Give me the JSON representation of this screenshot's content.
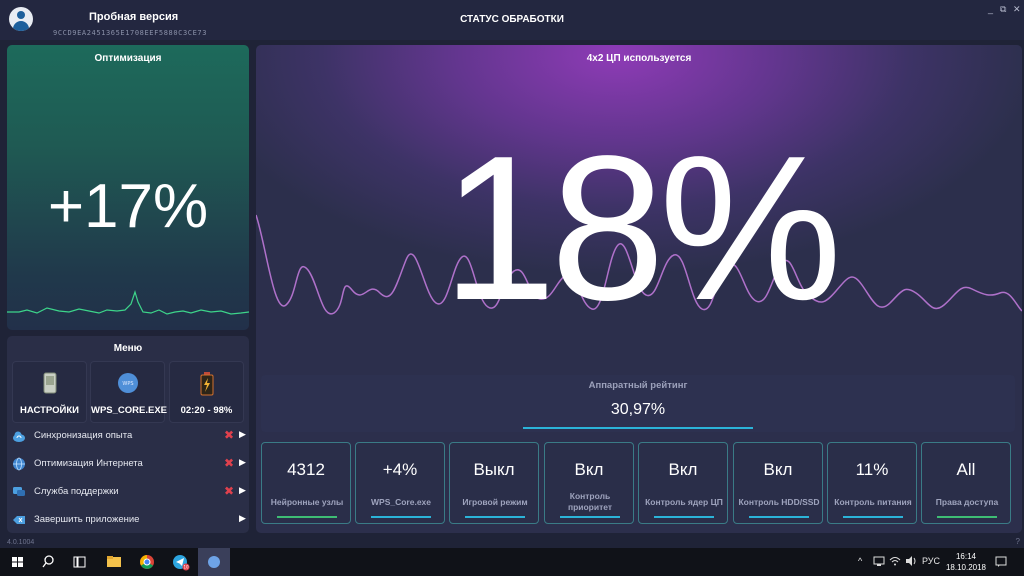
{
  "titlebar": {
    "app_title": "Пробная версия",
    "app_id": "9CCD9EA2451365E1708EEF5880C3CE73",
    "center_title": "СТАТУС ОБРАБОТКИ",
    "minimize": "_",
    "restore": "⧉",
    "close": "✕"
  },
  "optimization": {
    "title": "Оптимизация",
    "value": "+17%"
  },
  "menu": {
    "title": "Меню",
    "tiles": [
      {
        "label": "НАСТРОЙКИ",
        "icon": "device-settings-icon"
      },
      {
        "label": "WPS_CORE.EXE",
        "icon": "wps-core-icon"
      },
      {
        "label": "02:20 - 98%",
        "icon": "battery-icon"
      }
    ],
    "items": [
      {
        "label": "Синхронизация опыта",
        "icon": "cloud-sync-icon"
      },
      {
        "label": "Оптимизация Интернета",
        "icon": "globe-icon"
      },
      {
        "label": "Служба поддержки",
        "icon": "chat-icon"
      },
      {
        "label": "Завершить приложение",
        "icon": "exit-icon"
      }
    ],
    "disabled_mark": "✖",
    "arrow": "▶"
  },
  "cpu": {
    "title": "4x2 ЦП используется",
    "value": "18%"
  },
  "rating": {
    "label": "Аппаратный рейтинг",
    "value": "30,97%"
  },
  "cards": [
    {
      "value": "4312",
      "label": "Нейронные узлы",
      "bar_color": "#3ebd74"
    },
    {
      "value": "+4%",
      "label": "WPS_Core.exe",
      "bar_color": "#2bb3d8"
    },
    {
      "value": "Выкл",
      "label": "Игровой режим",
      "bar_color": "#2bb3d8"
    },
    {
      "value": "Вкл",
      "label": "Контроль приоритет",
      "bar_color": "#2bb3d8"
    },
    {
      "value": "Вкл",
      "label": "Контроль ядер ЦП",
      "bar_color": "#2bb3d8"
    },
    {
      "value": "Вкл",
      "label": "Контроль HDD/SSD",
      "bar_color": "#2bb3d8"
    },
    {
      "value": "11%",
      "label": "Контроль питания",
      "bar_color": "#2bb3d8"
    },
    {
      "value": "All",
      "label": "Права доступа",
      "bar_color": "#3ebd74"
    }
  ],
  "footer": {
    "version": "4.0.1004",
    "help": "?"
  },
  "taskbar": {
    "tray_arrow": "^",
    "lang": "РУС",
    "time": "16:14",
    "date": "18.10.2018",
    "telegram_badge": "10"
  },
  "colors": {
    "accent_cyan": "#2bb3d8",
    "accent_green": "#3ebd74",
    "cpu_wave": "#c77ce0",
    "opt_wave": "#3dd58a",
    "error_red": "#e0414d"
  }
}
